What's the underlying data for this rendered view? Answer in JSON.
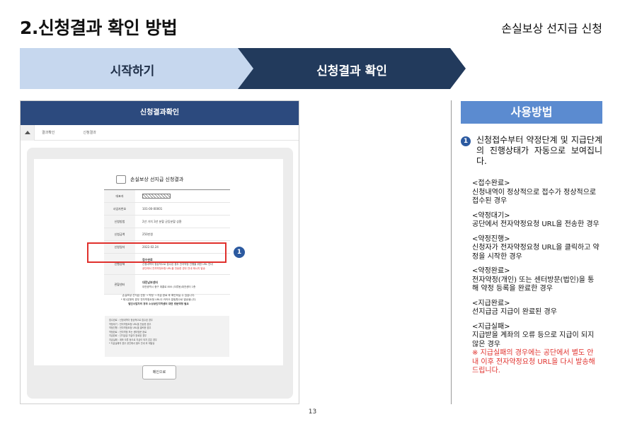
{
  "page": {
    "title": "2.신청결과 확인 방법",
    "subtitle": "손실보상 선지급 신청",
    "page_number": "13"
  },
  "steps": [
    {
      "label": "시작하기",
      "state": "inactive"
    },
    {
      "label": "신청결과 확인",
      "state": "active"
    }
  ],
  "screenshot": {
    "header": "신청결과확인",
    "breadcrumb": [
      "결과확인",
      "신청결과"
    ],
    "card_title": "손실보상 선지급 신청결과",
    "rows": [
      {
        "key": "대표자",
        "value": ""
      },
      {
        "key": "사업자번호",
        "value": "101-00-00001"
      },
      {
        "key": "신청방법",
        "value": "2년 거치 3년 분할 균등분할 상환"
      },
      {
        "key": "신청금액",
        "value": "250만원"
      },
      {
        "key": "신청일자",
        "value": "2022.02.24"
      },
      {
        "key": "진행상태",
        "value": "접수완료"
      },
      {
        "key": "관할센터",
        "value": "대전남부센터"
      }
    ],
    "status_detail": "신청내역이 정상적으로 접수된 경우 전자약정 진행을 위한 URL 안내",
    "status_detail_red": "공단에서 전자약정요청 URL을 전송한 경우 안내 메시지 발송",
    "center_detail": "대전광역시 중구 계룡로 800 (오류동)대전센터 1층",
    "notice_line1": "손실보상 선지급 신청 → 약정 → 지급 완료 후 확인하실 수 있습니다.",
    "notice_line2": "* 제1유형의 경우 전자약정요청 URL이 카카오 알림톡으로 발송됩니다.",
    "notice_line3": "법인사업자의 경우 소상공인지역센터 대면 방문약정 필요",
    "legend": [
      "접수완료 : 신청내역이 정상적으로 접수된 경우",
      "약정대기 : 전자약정요청 URL을 전송한 경우",
      "약정진행 : 전자약정요청 URL을 클릭한 경우",
      "약정완료 : 전자약정 또는 센터방문 완료",
      "지급완료 : 선지급금 지급이 완료된 경우",
      "지급실패 : 계좌 오류 등으로 지급이 되지 않은 경우",
      "* 지급실패의 경우 공단에서 별도 안내 후 재발송"
    ],
    "prev_button": "메인으로",
    "marker": "1"
  },
  "usage": {
    "header": "사용방법",
    "item_number": "1",
    "item_text": "신청접수부터 약정단계 및 지급단계의 진행상태가 자동으로 보여집니다.",
    "statuses": [
      {
        "name": "<접수완료>",
        "desc": "신청내역이 정상적으로 접수가 정상적으로 접수된 경우"
      },
      {
        "name": "<약정대기>",
        "desc": "공단에서 전자약정요청 URL을 전송한 경우"
      },
      {
        "name": "<약정진행>",
        "desc": "신청자가 전자약정요청 URL을 클릭하고 약정을 시작한 경우"
      },
      {
        "name": "<약정완료>",
        "desc": "전자약정(개인) 또는 센터방문(법인)을 통해 약정 등록을 완료한 경우"
      },
      {
        "name": "<지급완료>",
        "desc": "선지급금 지급이 완료된 경우"
      },
      {
        "name": "<지급실패>",
        "desc": "지급받을 계좌의 오류 등으로 지급이 되지 않은 경우"
      }
    ],
    "warning": "※ 지급실패의 경우에는 공단에서 별도 안내 이후 전자약정요청 URL을 다시 발송해 드립니다."
  }
}
